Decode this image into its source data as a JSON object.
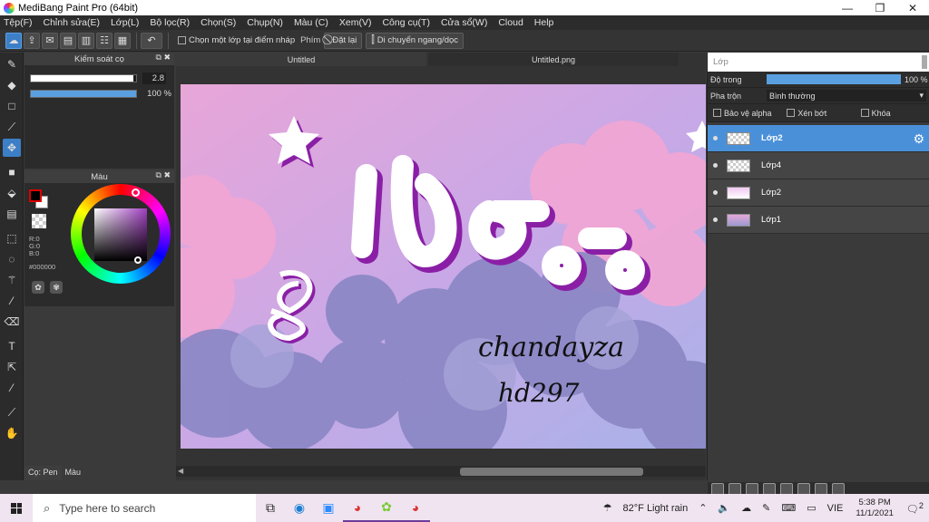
{
  "window": {
    "title": "MediBang Paint Pro (64bit)",
    "minimize": "—",
    "maximize": "❐",
    "close": "✕"
  },
  "menu": [
    "Tệp(F)",
    "Chỉnh sửa(E)",
    "Lớp(L)",
    "Bộ lọc(R)",
    "Chọn(S)",
    "Chụp(N)",
    "Màu (C)",
    "Xem(V)",
    "Công cụ(T)",
    "Cửa sổ(W)",
    "Cloud",
    "Help"
  ],
  "toolbar": {
    "select_one_layer_label": "Chọn một lớp tại điểm nháp",
    "key_label": "Phím",
    "reset_label": "Đặt lại",
    "move_label": "Di chuyển ngang/dọc"
  },
  "brush_panel": {
    "title": "Kiểm soát cọ",
    "size_value": "2.8",
    "size_fraction": 0.97,
    "opacity_value": "100 %",
    "opacity_fraction": 1.0
  },
  "color_panel": {
    "title": "Màu",
    "r": "R:0",
    "g": "G:0",
    "b": "B:0",
    "hex": "#000000"
  },
  "left_tabs": [
    "Cọ: Pen",
    "Màu"
  ],
  "doc_tabs": [
    "Untitled",
    "Untitled.png"
  ],
  "canvas": {
    "signature_line1": "chandayza",
    "signature_line2": "hd297"
  },
  "layer_panel": {
    "title": "Lớp",
    "opacity_label": "Độ trong",
    "opacity_value": "100 %",
    "blend_label": "Pha trộn",
    "blend_value": "Bình thường",
    "protect_alpha": "Bảo vệ alpha",
    "clip": "Xén bớt",
    "lock": "Khóa",
    "layers": [
      "Lớp2",
      "Lớp4",
      "Lớp2",
      "Lớp1"
    ]
  },
  "taskbar": {
    "search_placeholder": "Type here to search",
    "weather": "82°F  Light rain",
    "lang": "VIE",
    "time": "5:38 PM",
    "date": "11/1/2021",
    "notifications": "2"
  },
  "colors": {
    "accent": "#4a90d9",
    "panel": "#2b2b2b",
    "taskbar": "#f0e4f0"
  }
}
